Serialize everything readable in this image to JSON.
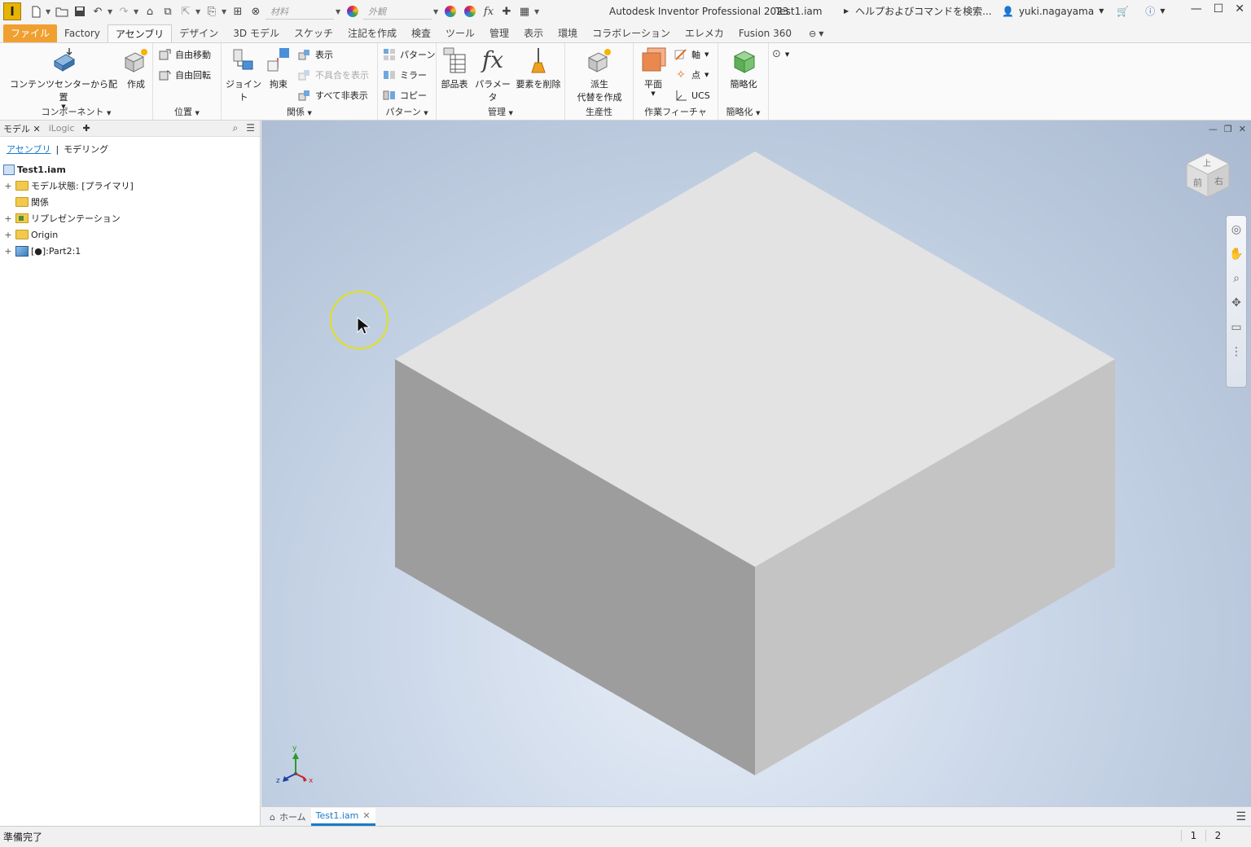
{
  "titlebar": {
    "app_logo": "I",
    "material_placeholder": "材料",
    "appearance_placeholder": "外観",
    "app_title": "Autodesk Inventor Professional 2023",
    "file_name": "Test1.iam",
    "search_text": "ヘルプおよびコマンドを検索...",
    "user_name": "yuki.nagayama"
  },
  "menu_tabs": [
    "ファイル",
    "Factory",
    "アセンブリ",
    "デザイン",
    "3D モデル",
    "スケッチ",
    "注記を作成",
    "検査",
    "ツール",
    "管理",
    "表示",
    "環境",
    "コラボレーション",
    "エレメカ",
    "Fusion 360"
  ],
  "active_tab": "アセンブリ",
  "ribbon": {
    "component": {
      "title": "コンポーネント",
      "place": "コンテンツセンターから配置",
      "create": "作成"
    },
    "position": {
      "title": "位置",
      "free_move": "自由移動",
      "free_rotate": "自由回転"
    },
    "relationships": {
      "title": "関係",
      "joint": "ジョイント",
      "constrain": "拘束",
      "show": "表示",
      "show_sick": "不具合を表示",
      "hide_all": "すべて非表示"
    },
    "pattern": {
      "title": "パターン",
      "pattern": "パターン",
      "mirror": "ミラー",
      "copy": "コピー"
    },
    "manage": {
      "title": "管理",
      "bom": "部品表",
      "parameters": "パラメータ",
      "delete": "要素を削除"
    },
    "productivity": {
      "title": "生産性",
      "derive_1": "派生",
      "derive_2": "代替を作成"
    },
    "work_features": {
      "title": "作業フィーチャ",
      "plane": "平面",
      "axis": "軸",
      "point": "点",
      "ucs": "UCS"
    },
    "simplify": {
      "title": "簡略化",
      "simplify": "簡略化"
    }
  },
  "browser": {
    "tab_model": "モデル",
    "tab_ilogic": "iLogic",
    "sub_assembly": "アセンブリ",
    "sub_modeling": "モデリング",
    "tree": [
      {
        "label": "Test1.iam"
      },
      {
        "label": "モデル状態: [プライマリ]"
      },
      {
        "label": "関係"
      },
      {
        "label": "リプレゼンテーション"
      },
      {
        "label": "Origin"
      },
      {
        "label": "[●]:Part2:1"
      }
    ]
  },
  "viewcube": {
    "top": "上",
    "front": "前",
    "right": "右"
  },
  "axis": {
    "x": "x",
    "y": "y",
    "z": "z"
  },
  "doc_tabs": {
    "home": "ホーム",
    "file": "Test1.iam"
  },
  "status": {
    "text": "準備完了",
    "num1": "1",
    "num2": "2"
  },
  "colors": {
    "file_tab": "#f0a030",
    "accent": "#1a7ac9",
    "cursor_ring": "#e0e020"
  }
}
